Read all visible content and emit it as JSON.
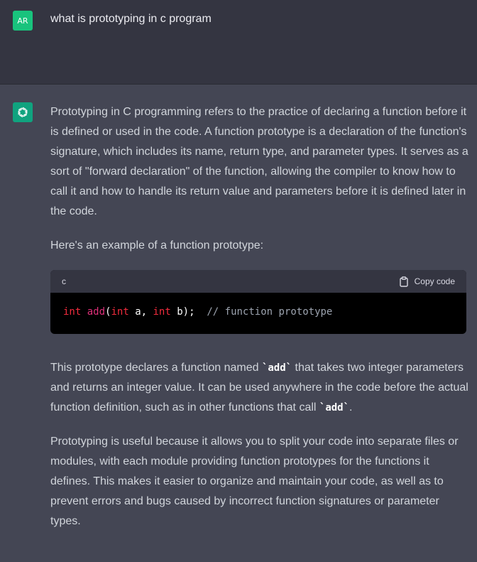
{
  "user": {
    "initials": "AR",
    "message": "what is prototyping in c program"
  },
  "assistant": {
    "paragraph1": "Prototyping in C programming refers to the practice of declaring a function before it is defined or used in the code. A function prototype is a declaration of the function's signature, which includes its name, return type, and parameter types. It serves as a sort of \"forward declaration\" of the function, allowing the compiler to know how to call it and how to handle its return value and parameters before it is defined later in the code.",
    "paragraph2": "Here's an example of a function prototype:",
    "code": {
      "language": "c",
      "copy_label": "Copy code",
      "tokens": {
        "kw_int1": "int",
        "fn_add": "add",
        "paren_open": "(",
        "kw_int2": "int",
        "param_a": " a, ",
        "kw_int3": "int",
        "param_b": " b);  ",
        "comment": "// function prototype"
      }
    },
    "paragraph3": {
      "before": "This prototype declares a function named ",
      "code1": "`add`",
      "middle": " that takes two integer parameters and returns an integer value. It can be used anywhere in the code before the actual function definition, such as in other functions that call ",
      "code2": "`add`",
      "after": "."
    },
    "paragraph4": "Prototyping is useful because it allows you to split your code into separate files or modules, with each module providing function prototypes for the functions it defines. This makes it easier to organize and maintain your code, as well as to prevent errors and bugs caused by incorrect function signatures or parameter types."
  },
  "colors": {
    "user_bg": "#343541",
    "assistant_bg": "#444654",
    "user_avatar": "#19c37d",
    "gpt_avatar": "#10a37f",
    "code_keyword": "#f22c3d",
    "code_function": "#df3079",
    "code_comment": "#9ca3af"
  }
}
